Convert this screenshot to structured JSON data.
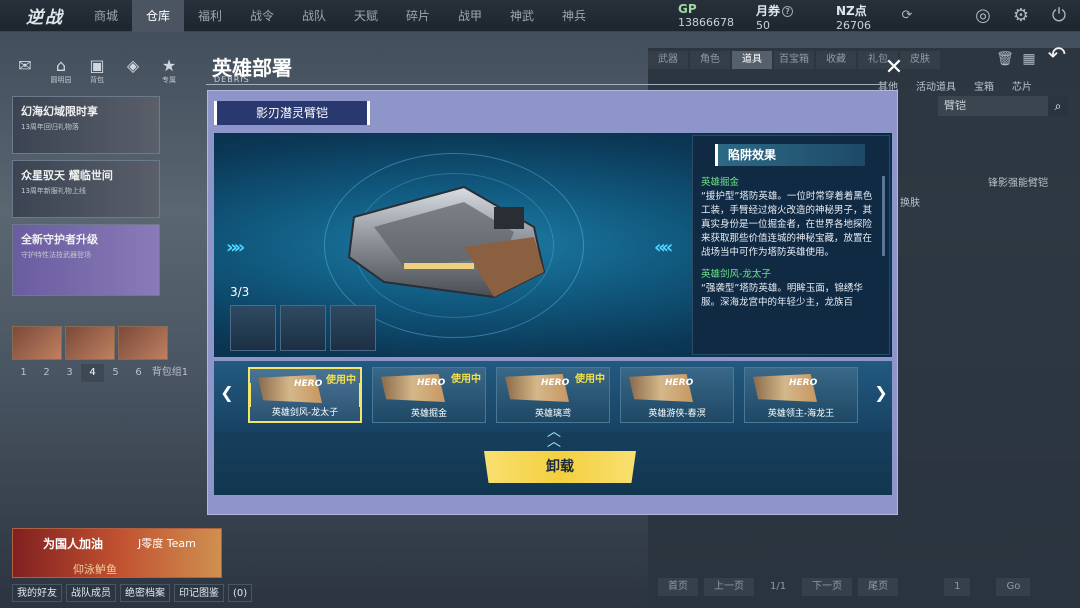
{
  "topbar": {
    "logo": "逆战",
    "tabs": [
      "商城",
      "仓库",
      "福利",
      "战令",
      "战队",
      "天赋",
      "碎片",
      "战甲",
      "神武",
      "神兵"
    ],
    "active_tab": 1,
    "currency": [
      {
        "label": "GP",
        "value": "13866678"
      },
      {
        "label": "月券",
        "value": "50"
      },
      {
        "label": "NZ点",
        "value": "26706"
      }
    ]
  },
  "left": {
    "icons": [
      "",
      "圆明园",
      "背包",
      "",
      "专属"
    ],
    "promos": [
      {
        "title": "幻海幻域限时享",
        "sub": "13周年回归礼物落"
      },
      {
        "title": "众星驭天 耀临世间",
        "sub": "13周年新服礼物上线"
      },
      {
        "title": "全新守护者升级",
        "sub": "守护特性法技武器登场"
      }
    ],
    "pager": [
      "1",
      "2",
      "3",
      "4",
      "5",
      "6"
    ],
    "bag_label": "背包组1",
    "friend_banner": {
      "a": "为国人加油",
      "b": "J零度 Team",
      "c": "仰泳鲈鱼"
    },
    "bottom_tabs": [
      "我的好友",
      "战队成员",
      "绝密档案",
      "印记图鉴"
    ],
    "mail_count": "(0)"
  },
  "right": {
    "tabs": [
      "武器",
      "角色",
      "道具",
      "百宝箱",
      "收藏",
      "礼包",
      "皮肤"
    ],
    "active_tab": 2,
    "subtabs": [
      "其他",
      "活动道具",
      "宝箱",
      "芯片"
    ],
    "search_value": "臂铠",
    "item_label": "锋影强能臂铠",
    "swap_label": "换肤",
    "pager": {
      "first": "首页",
      "prev": "上一页",
      "page": "1/1",
      "next": "下一页",
      "last": "尾页",
      "input": "1",
      "go": "Go"
    }
  },
  "modal": {
    "title": "英雄部署",
    "subtitle": "DEBRIS",
    "item_tab": "影刃潜灵臂铠",
    "count": "3/3",
    "effect_title": "陷阱效果",
    "effects": [
      {
        "name": "英雄掘金",
        "desc": "“援护型”塔防英雄。一位时常穿着着黑色工装，手臂经过熔火改造的神秘男子，其真实身份是一位掘金者，在世界各地探险来获取那些价值连城的神秘宝藏，放置在战场当中可作为塔防英雄使用。"
      },
      {
        "name": "英雄剑风-龙太子",
        "desc": "“强袭型”塔防英雄。明眸玉面，锦绣华服。深海龙宫中的年轻少主，龙族百"
      }
    ],
    "heroes": [
      {
        "name": "英雄剑风-龙太子",
        "in_use": "使用中",
        "selected": true
      },
      {
        "name": "英雄掘金",
        "in_use": "使用中",
        "selected": false
      },
      {
        "name": "英雄璃鸢",
        "in_use": "使用中",
        "selected": false
      },
      {
        "name": "英雄游侠-春溟",
        "in_use": "",
        "selected": false
      },
      {
        "name": "英雄领主-海龙王",
        "in_use": "",
        "selected": false
      }
    ],
    "hero_tag": "HERO",
    "unload_label": "卸载"
  },
  "colors": {
    "accent": "#f2e56a",
    "modal": "#8e95c8",
    "green_name": "#6ee38a"
  }
}
